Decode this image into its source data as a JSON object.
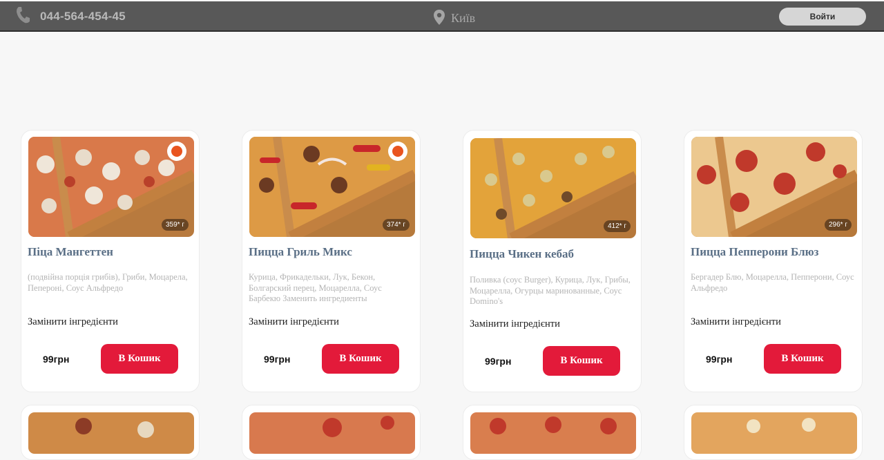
{
  "header": {
    "phone": "044-564-454-45",
    "city": "Київ",
    "login_label": "Войти",
    "icons": {
      "phone": "phone-icon",
      "location": "map-pin-icon"
    }
  },
  "colors": {
    "header_bg": "#585858",
    "accent": "#e31a3a",
    "title": "#5a6f86"
  },
  "products": [
    {
      "title": "Піца Мангеттен",
      "ingredients": "(подвійна порція грибів), Гриби, Моцарела, Пепероні, Соус Альфредо",
      "weight": "359* г",
      "change_label": "Замінити інгредієнти",
      "price": "99грн",
      "cart_label": "В Кошик",
      "has_badge": true
    },
    {
      "title": "Пицца Гриль Микс",
      "ingredients": "Курица, Фрикадельки, Лук, Бекон, Болгарский перец, Моцарелла, Соус Барбекю Заменить ингредиенты",
      "weight": "374* г",
      "change_label": "Замінити інгредієнти",
      "price": "99грн",
      "cart_label": "В Кошик",
      "has_badge": true
    },
    {
      "title": "Пицца Чикен кебаб",
      "ingredients": "Поливка (соус Burger), Курица, Лук, Грибы, Моцарелла, Огурцы маринованные, Соус Domino's",
      "weight": "412* г",
      "change_label": "Замінити інгредієнти",
      "price": "99грн",
      "cart_label": "В Кошик",
      "has_badge": false
    },
    {
      "title": "Пицца Пепперони Блюз",
      "ingredients": "Бергадер Блю, Моцарелла, Пепперони, Соус Альфредо",
      "weight": "296* г",
      "change_label": "Замінити інгредієнти",
      "price": "99грн",
      "cart_label": "В Кошик",
      "has_badge": false
    }
  ]
}
